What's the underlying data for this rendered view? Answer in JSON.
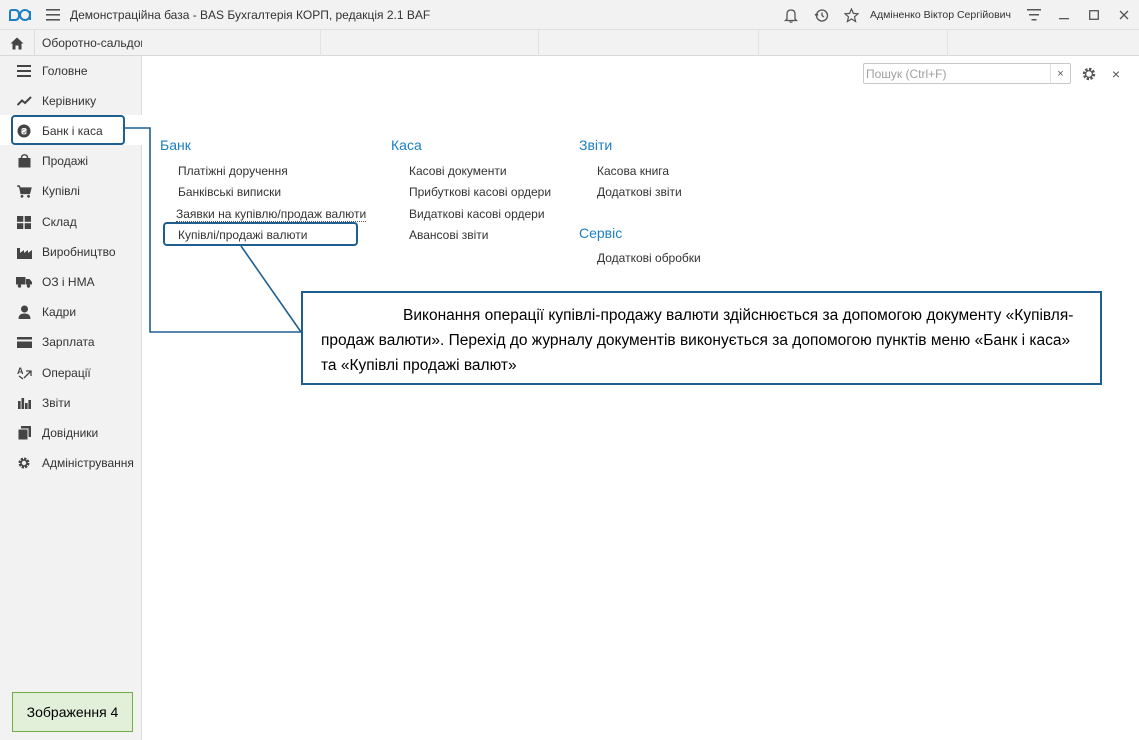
{
  "app": {
    "title": "Демонстраційна база - BAS Бухгалтерія КОРП, редакція 2.1 BAF",
    "user": "Адміненко Віктор Сергійович"
  },
  "tabs": {
    "home_icon": "home-icon",
    "open_tab": "Оборотно-сальдова"
  },
  "sidebar": {
    "items": [
      {
        "label": "Головне",
        "icon": "menu-lines-icon"
      },
      {
        "label": "Керівнику",
        "icon": "trend-icon"
      },
      {
        "label": "Банк і каса",
        "icon": "coin-icon"
      },
      {
        "label": "Продажі",
        "icon": "bag-icon"
      },
      {
        "label": "Купівлі",
        "icon": "cart-icon"
      },
      {
        "label": "Склад",
        "icon": "grid-icon"
      },
      {
        "label": "Виробництво",
        "icon": "factory-icon"
      },
      {
        "label": "ОЗ і НМА",
        "icon": "truck-icon"
      },
      {
        "label": "Кадри",
        "icon": "person-icon"
      },
      {
        "label": "Зарплата",
        "icon": "card-icon"
      },
      {
        "label": "Операції",
        "icon": "operations-icon"
      },
      {
        "label": "Звіти",
        "icon": "bar-chart-icon"
      },
      {
        "label": "Довідники",
        "icon": "books-icon"
      },
      {
        "label": "Адміністрування",
        "icon": "gear-icon"
      }
    ],
    "active_index": 2
  },
  "search": {
    "placeholder": "Пошук (Ctrl+F)",
    "clear": "×"
  },
  "close_label": "×",
  "sections": {
    "bank": {
      "title": "Банк",
      "links": [
        "Платіжні доручення",
        "Банківські виписки",
        "Заявки на купівлю/продаж валюти",
        "Купівлі/продажі валюти"
      ]
    },
    "cash": {
      "title": "Каса",
      "links": [
        "Касові документи",
        "Прибуткові касові ордери",
        "Видаткові касові ордери",
        "Авансові звіти"
      ]
    },
    "reports": {
      "title": "Звіти",
      "links": [
        "Касова книга",
        "Додаткові звіти"
      ]
    },
    "service": {
      "title": "Сервіс",
      "links": [
        "Додаткові обробки"
      ]
    }
  },
  "callout": {
    "text": "Виконання операції купівлі-продажу валюти здійснюється за допомогою документу «Купівля-продаж валюти». Перехід до журналу документів виконується за допомогою пунктів меню «Банк і каса» та «Купівлі продажі валют»"
  },
  "caption": "Зображення 4",
  "colors": {
    "accent": "#1b7fc2",
    "annotation": "#1f5f8f",
    "caption_bg": "#e2efd9",
    "caption_border": "#70ad47"
  }
}
